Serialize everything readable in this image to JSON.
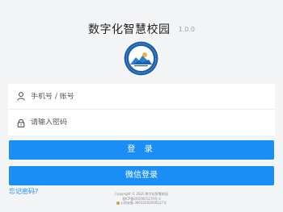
{
  "header": {
    "title": "数字化智慧校园",
    "version": "1.0.0"
  },
  "logo": {
    "icon": "school-emblem-icon",
    "colors": {
      "ring": "#1f5fae",
      "inner": "#ffffff",
      "mountain": "#2c7fd0",
      "sun": "#e9b43a"
    }
  },
  "form": {
    "username": {
      "icon": "user-icon",
      "placeholder": "手机号 / 账号",
      "value": ""
    },
    "password": {
      "icon": "lock-icon",
      "placeholder": "请输入密码",
      "value": ""
    }
  },
  "buttons": {
    "login_label": "登 录",
    "wechat_login_label": "微信登录"
  },
  "links": {
    "forgot_password": "忘记密码?"
  },
  "footer": {
    "copyright": "Copyright © 2020 数字化智慧校园",
    "icp": "晋ICP备2020001270号-2",
    "beian": "公网安备 36010202000127号"
  },
  "theme": {
    "primary": "#1b8ef5",
    "background": "#f3f4f6"
  }
}
